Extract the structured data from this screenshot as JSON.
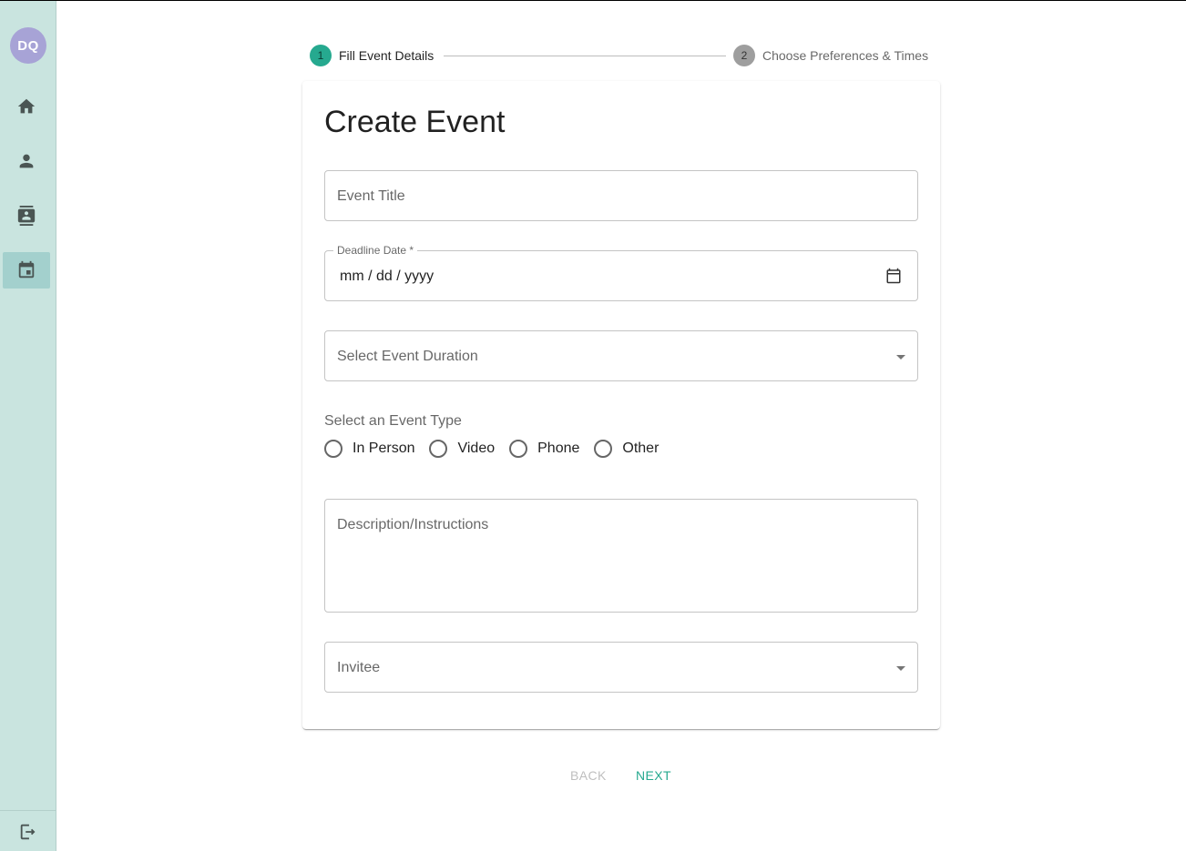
{
  "sidebar": {
    "avatar_initials": "DQ",
    "items": [
      {
        "icon": "home-icon"
      },
      {
        "icon": "person-icon"
      },
      {
        "icon": "contacts-icon"
      },
      {
        "icon": "calendar-event-icon",
        "active": true
      }
    ],
    "logout_icon": "logout-icon"
  },
  "stepper": {
    "steps": [
      {
        "number": "1",
        "label": "Fill Event Details",
        "active": true
      },
      {
        "number": "2",
        "label": "Choose Preferences & Times",
        "active": false
      }
    ]
  },
  "form": {
    "title": "Create Event",
    "event_title_placeholder": "Event Title",
    "deadline_label": "Deadline Date *",
    "deadline_value": "mm / dd / yyyy",
    "duration_placeholder": "Select Event Duration",
    "event_type_label": "Select an Event Type",
    "event_types": [
      "In Person",
      "Video",
      "Phone",
      "Other"
    ],
    "description_placeholder": "Description/Instructions",
    "invitee_placeholder": "Invitee"
  },
  "actions": {
    "back_label": "BACK",
    "next_label": "NEXT"
  },
  "colors": {
    "accent": "#26a98f",
    "sidebar_bg": "#c9e4df",
    "avatar_bg": "#a7a3d6"
  }
}
